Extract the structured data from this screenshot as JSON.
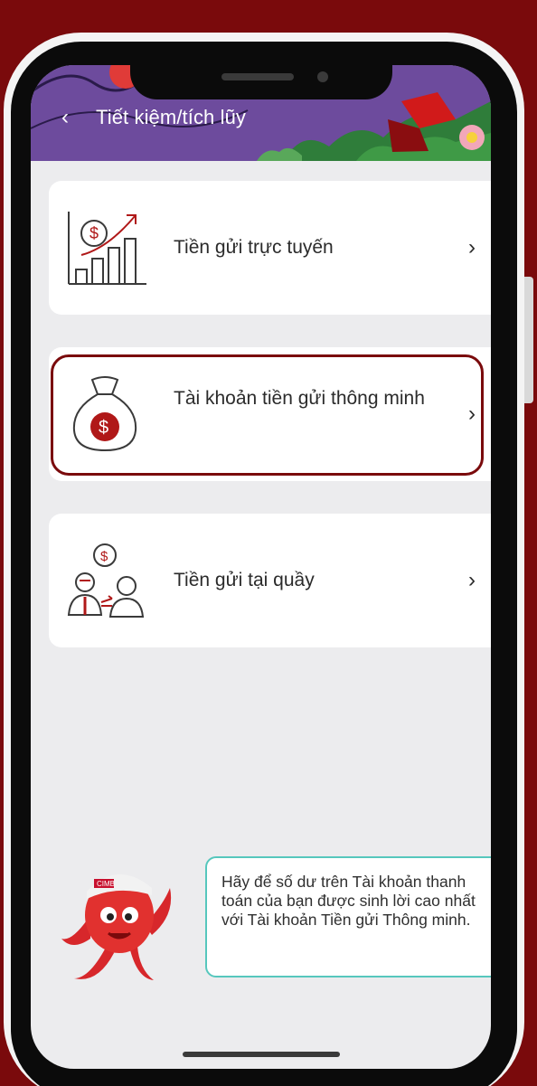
{
  "header": {
    "back_icon": "chevron-left-icon",
    "title": "Tiết kiệm/tích lũy"
  },
  "options": [
    {
      "label": "Tiền gửi trực tuyến",
      "icon": "savings-chart-icon",
      "chevron": "›"
    },
    {
      "label": "Tài khoản tiền gửi thông minh",
      "icon": "money-bag-icon",
      "chevron": "›",
      "highlighted": true
    },
    {
      "label": "Tiền gửi tại quầy",
      "icon": "counter-exchange-icon",
      "chevron": "›"
    }
  ],
  "tooltip": {
    "text": "Hãy để số dư trên Tài khoản thanh toán của bạn được sinh lời cao nhất với Tài khoản Tiền gửi Thông minh."
  },
  "mascot": {
    "brand": "CIMB"
  },
  "colors": {
    "background": "#7a0a0c",
    "accent": "#7a0a0c",
    "tooltip_border": "#56c7bd",
    "header": "#6b4a9c"
  }
}
